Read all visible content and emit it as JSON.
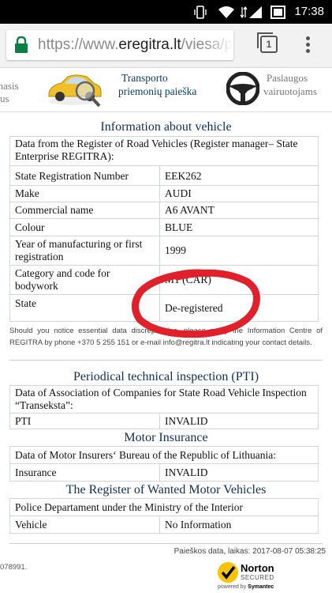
{
  "status_bar": {
    "time": "17:38"
  },
  "browser": {
    "url_host": "https://www.",
    "url_domain": "eregitra.lt",
    "url_path": "/viesa/pa",
    "tab_count": "1"
  },
  "site_nav": {
    "left_line1": "masis",
    "left_line2": "us",
    "mid_line1": "Transporto",
    "mid_line2": "priemonių paieška",
    "right_line1": "Paslaugos",
    "right_line2": "vairuotojams"
  },
  "vehicle": {
    "title": "Information about vehicle",
    "source": "Data from the Register of Road Vehicles (Register manager– State Enterprise REGITRA):",
    "rows": [
      {
        "label": "State Registration Number",
        "value": "EEK262"
      },
      {
        "label": "Make",
        "value": "AUDI"
      },
      {
        "label": "Commercial name",
        "value": "A6 AVANT"
      },
      {
        "label": "Colour",
        "value": "BLUE"
      },
      {
        "label": "Year of manufacturing or first registration",
        "value": "1999"
      },
      {
        "label": "Category and code for bodywork",
        "value": "M1 (CAR)"
      },
      {
        "label": "State",
        "value": "De-registered"
      }
    ],
    "note": "Should you notice essential data discrepancies, please notify the Information Centre of REGITRA by phone +370 5 255 151 or e-mail info@regitra.lt indicating your contact details."
  },
  "pti": {
    "title": "Periodical technical inspection (PTI)",
    "source": "Data of Association of Companies for State Road Vehicle Inspection “Transeksta”:",
    "label": "PTI",
    "value": "INVALID"
  },
  "insurance": {
    "title": "Motor Insurance",
    "source": "Data of Motor Insurers‘ Bureau of the Republic of Lithuania:",
    "label": "Insurance",
    "value": "INVALID"
  },
  "wanted": {
    "title": "The Register of Wanted Motor Vehicles",
    "source": "Police Departament under the Ministry of the Interior",
    "label": "Vehicle",
    "value": "No Information"
  },
  "footer": {
    "search_date": "Paieškos data, laikas: 2017-08-07 05:38:25",
    "phone_fragment": "078991.",
    "norton_name": "Norton",
    "norton_secured": "SECURED",
    "norton_powered": "powered by",
    "norton_symantec": "Symantec"
  },
  "colors": {
    "accent": "#0f2f5a",
    "marker": "#e0202a"
  }
}
